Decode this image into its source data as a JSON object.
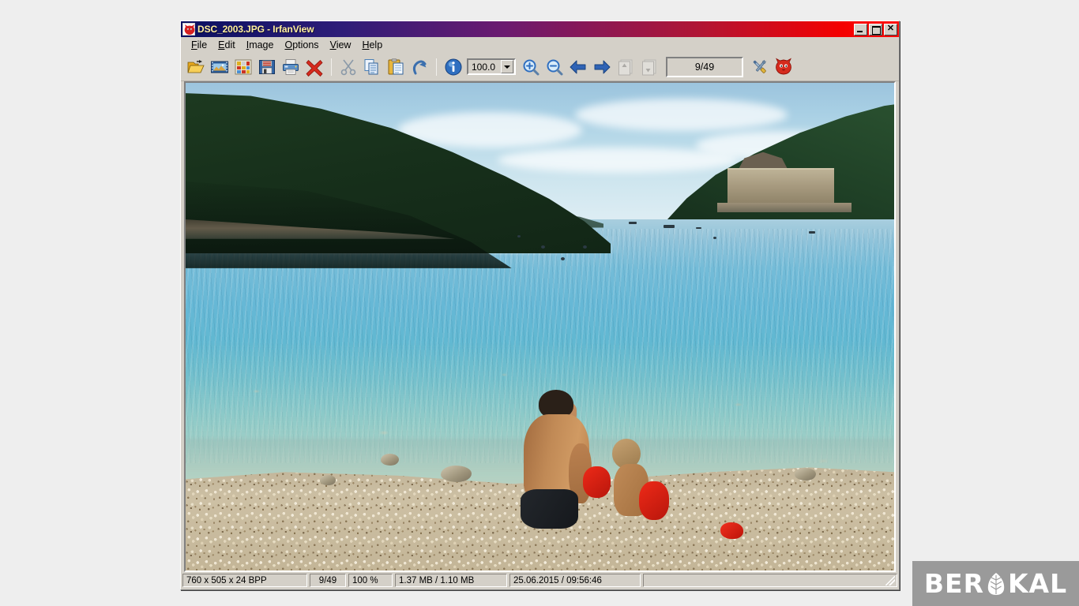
{
  "window": {
    "title": "DSC_2003.JPG - IrfanView",
    "app_icon": "irfanview-cat-icon",
    "caption_buttons": [
      {
        "name": "minimize",
        "label": "_"
      },
      {
        "name": "maximize",
        "label": "□"
      },
      {
        "name": "close",
        "label": "✕"
      }
    ],
    "title_gradient_start": "#0a1060",
    "title_gradient_end": "#ff0a06",
    "title_text_color": "#ffef9e",
    "chrome_color": "#d4d0c8"
  },
  "menu": {
    "items": [
      {
        "label": "File",
        "mnemonic": "F"
      },
      {
        "label": "Edit",
        "mnemonic": "E"
      },
      {
        "label": "Image",
        "mnemonic": "I"
      },
      {
        "label": "Options",
        "mnemonic": "O"
      },
      {
        "label": "View",
        "mnemonic": "V"
      },
      {
        "label": "Help",
        "mnemonic": "H"
      }
    ]
  },
  "toolbar": {
    "buttons": [
      {
        "name": "open-icon",
        "tooltip": "Open"
      },
      {
        "name": "slideshow-icon",
        "tooltip": "Slideshow"
      },
      {
        "name": "thumbnails-icon",
        "tooltip": "Thumbnails"
      },
      {
        "name": "save-icon",
        "tooltip": "Save"
      },
      {
        "name": "print-icon",
        "tooltip": "Print"
      },
      {
        "name": "delete-icon",
        "tooltip": "Delete"
      },
      {
        "name": "cut-icon",
        "tooltip": "Cut"
      },
      {
        "name": "copy-icon",
        "tooltip": "Copy"
      },
      {
        "name": "paste-icon",
        "tooltip": "Paste"
      },
      {
        "name": "undo-icon",
        "tooltip": "Undo"
      },
      {
        "name": "info-icon",
        "tooltip": "Information"
      },
      {
        "name": "zoom-in-icon",
        "tooltip": "Zoom In"
      },
      {
        "name": "zoom-out-icon",
        "tooltip": "Zoom Out"
      },
      {
        "name": "previous-icon",
        "tooltip": "Previous"
      },
      {
        "name": "next-icon",
        "tooltip": "Next"
      },
      {
        "name": "first-page-icon",
        "tooltip": "First",
        "disabled": true
      },
      {
        "name": "last-page-icon",
        "tooltip": "Last",
        "disabled": true
      },
      {
        "name": "settings-icon",
        "tooltip": "Properties/Settings"
      },
      {
        "name": "mascot-icon",
        "tooltip": "About IrfanView"
      }
    ],
    "zoom_value": "100.0",
    "page_counter": "9/49"
  },
  "status_bar": {
    "dimensions": "760 x 505 x 24 BPP",
    "index": "9/49",
    "zoom": "100 %",
    "size": "1.37 MB / 1.10 MB",
    "datetime": "25.06.2015 / 09:56:46"
  },
  "photo": {
    "description": "Adriatic pebble beach cove with a boy and toddler sitting at the waterline",
    "alt_summary": "clear turquoise sea, forested headland left, stone sea wall right, pebble beach foreground"
  },
  "watermark": {
    "text_before": "BER",
    "text_after": "KAL",
    "glyph": "leaf-icon",
    "background": "#9a9a9a",
    "text_color": "#ffffff"
  }
}
